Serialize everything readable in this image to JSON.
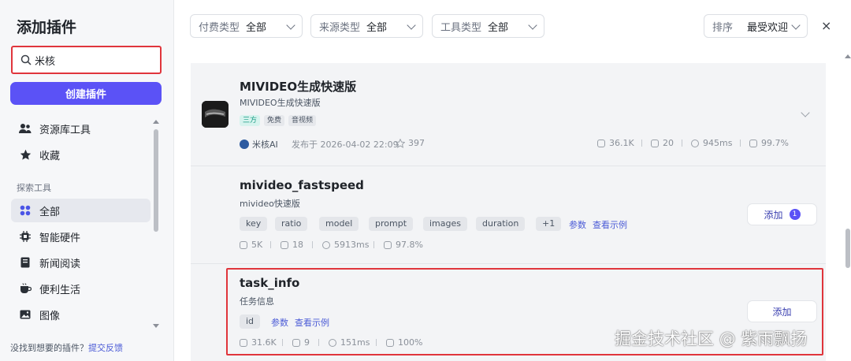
{
  "sidebar": {
    "title": "添加插件",
    "search_value": "米核",
    "create_label": "创建插件",
    "items": [
      {
        "label": "资源库工具"
      },
      {
        "label": "收藏"
      }
    ],
    "section_label": "探索工具",
    "explore": [
      {
        "label": "全部"
      },
      {
        "label": "智能硬件"
      },
      {
        "label": "新闻阅读"
      },
      {
        "label": "便利生活"
      },
      {
        "label": "图像"
      }
    ],
    "footer_text": "没找到想要的插件？",
    "footer_link": "提交反馈"
  },
  "filters": [
    {
      "label": "付费类型",
      "value": "全部"
    },
    {
      "label": "来源类型",
      "value": "全部"
    },
    {
      "label": "工具类型",
      "value": "全部"
    }
  ],
  "sort": {
    "label": "排序",
    "value": "最受欢迎"
  },
  "close_icon": "×",
  "plugin": {
    "title": "MIVIDEO生成快速版",
    "subtitle": "MIVIDEO生成快速版",
    "tags": [
      "三方",
      "免费",
      "音视频"
    ],
    "author": "米核AI",
    "published": "发布于 2026-04-02 22:09",
    "stars": "397",
    "stats": [
      "36.1K",
      "20",
      "945ms",
      "99.7%"
    ]
  },
  "tools": [
    {
      "title": "mivideo_fastspeed",
      "subtitle": "mivideo快速版",
      "params": [
        "key",
        "ratio",
        "model",
        "prompt",
        "images",
        "duration",
        "+1"
      ],
      "params_link": "参数",
      "example_link": "查看示例",
      "stats": [
        "5K",
        "18",
        "5913ms",
        "97.8%"
      ],
      "add_label": "添加",
      "add_badge": "1"
    },
    {
      "title": "task_info",
      "subtitle": "任务信息",
      "params": [
        "id"
      ],
      "params_link": "参数",
      "example_link": "查看示例",
      "stats": [
        "31.6K",
        "9",
        "151ms",
        "100%"
      ],
      "add_label": "添加"
    }
  ],
  "watermark": "掘金技术社区 @ 紫雨飘扬",
  "colors": {
    "accent": "#5b52f6",
    "highlight": "#e0353c",
    "link": "#4b5bd6"
  }
}
